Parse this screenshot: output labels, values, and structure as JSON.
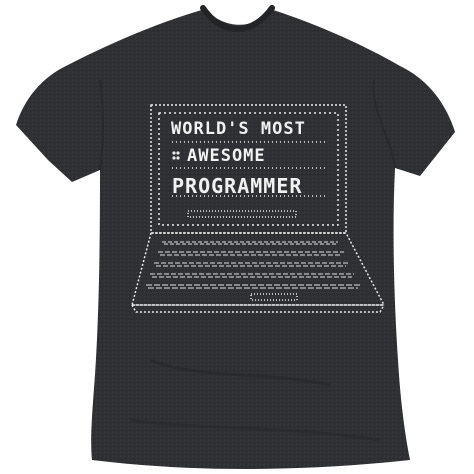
{
  "shirt": {
    "fabric_color": "#2f3033",
    "print_color": "#f2f2f2"
  },
  "print": {
    "line1": "WORLD'S MOST",
    "line2": "AWESOME",
    "line3": "PROGRAMMER"
  }
}
